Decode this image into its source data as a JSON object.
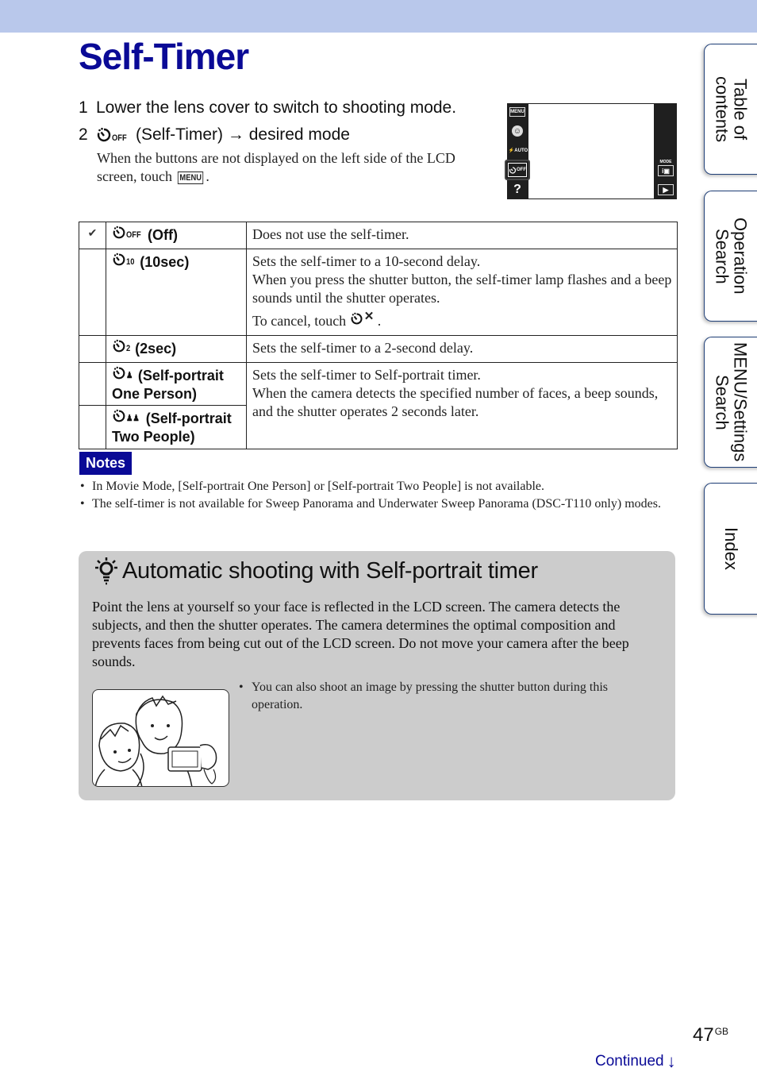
{
  "header": {
    "title": "Self-Timer",
    "bar_color": "#b9c8eb",
    "title_color": "#0a0a96"
  },
  "side_tabs": [
    {
      "label": "Table of\ncontents"
    },
    {
      "label": "Operation\nSearch"
    },
    {
      "label": "MENU/Settings\nSearch"
    },
    {
      "label": "Index"
    }
  ],
  "steps": [
    {
      "number": "1",
      "text": "Lower the lens cover to switch to shooting mode."
    },
    {
      "number": "2",
      "icon_sub": "OFF",
      "text": "(Self-Timer) → desired mode"
    }
  ],
  "step_desc": {
    "text": "When the buttons are not displayed on the left side of the LCD screen, touch",
    "menu_label": "MENU",
    "end": "."
  },
  "lcd": {
    "menu_button": "MENU",
    "face_icon": "☺",
    "flash_label": "⚡AUTO",
    "timer_sub": "OFF",
    "help_label": "?",
    "mode_label": "MODE",
    "mode_button": "i▣",
    "play_button": "▶"
  },
  "modes_table": {
    "rows": [
      {
        "default": true,
        "check": "✔",
        "icon_sub": "OFF",
        "name": "(Off)",
        "desc": [
          "Does not use the self-timer."
        ]
      },
      {
        "default": false,
        "check": "",
        "icon_sub": "10",
        "name": "(10sec)",
        "desc": [
          "Sets the self-timer to a 10-second delay.",
          "When you press the shutter button, the self-timer lamp flashes and a beep sounds until the shutter operates."
        ],
        "cancel_text": "To cancel, touch",
        "cancel_icon": "✕",
        "cancel_end": "."
      },
      {
        "default": false,
        "check": "",
        "icon_sub": "2",
        "name": "(2sec)",
        "desc": [
          "Sets the self-timer to a 2-second delay."
        ]
      },
      {
        "default": false,
        "check": "",
        "icon_sub": "♟",
        "name": "(Self-portrait One Person)",
        "desc": [
          "Sets the self-timer to Self-portrait timer.",
          "When the camera detects the specified number of faces, a beep sounds, and the shutter operates 2 seconds later."
        ]
      },
      {
        "default": false,
        "check": "",
        "icon_sub": "♟♟",
        "name": "(Self-portrait Two People)",
        "desc_shared_with_previous": true
      }
    ]
  },
  "notes": {
    "badge": "Notes",
    "items": [
      "In Movie Mode, [Self-portrait One Person] or [Self-portrait Two People] is not available.",
      "The self-timer is not available for Sweep Panorama and Underwater Sweep Panorama (DSC-T110 only) modes."
    ]
  },
  "tip": {
    "title": "Automatic shooting with Self-portrait timer",
    "body": "Point the lens at yourself so your face is reflected in the LCD screen. The camera detects the subjects, and then the shutter operates. The camera determines the optimal composition and prevents faces from being cut out of the LCD screen. Do not move your camera after the beep sounds.",
    "note": "You can also shoot an image by pressing the shutter button during this operation."
  },
  "footer": {
    "page_number": "47",
    "page_suffix": "GB",
    "continued": "Continued",
    "continued_arrow": "↓"
  }
}
